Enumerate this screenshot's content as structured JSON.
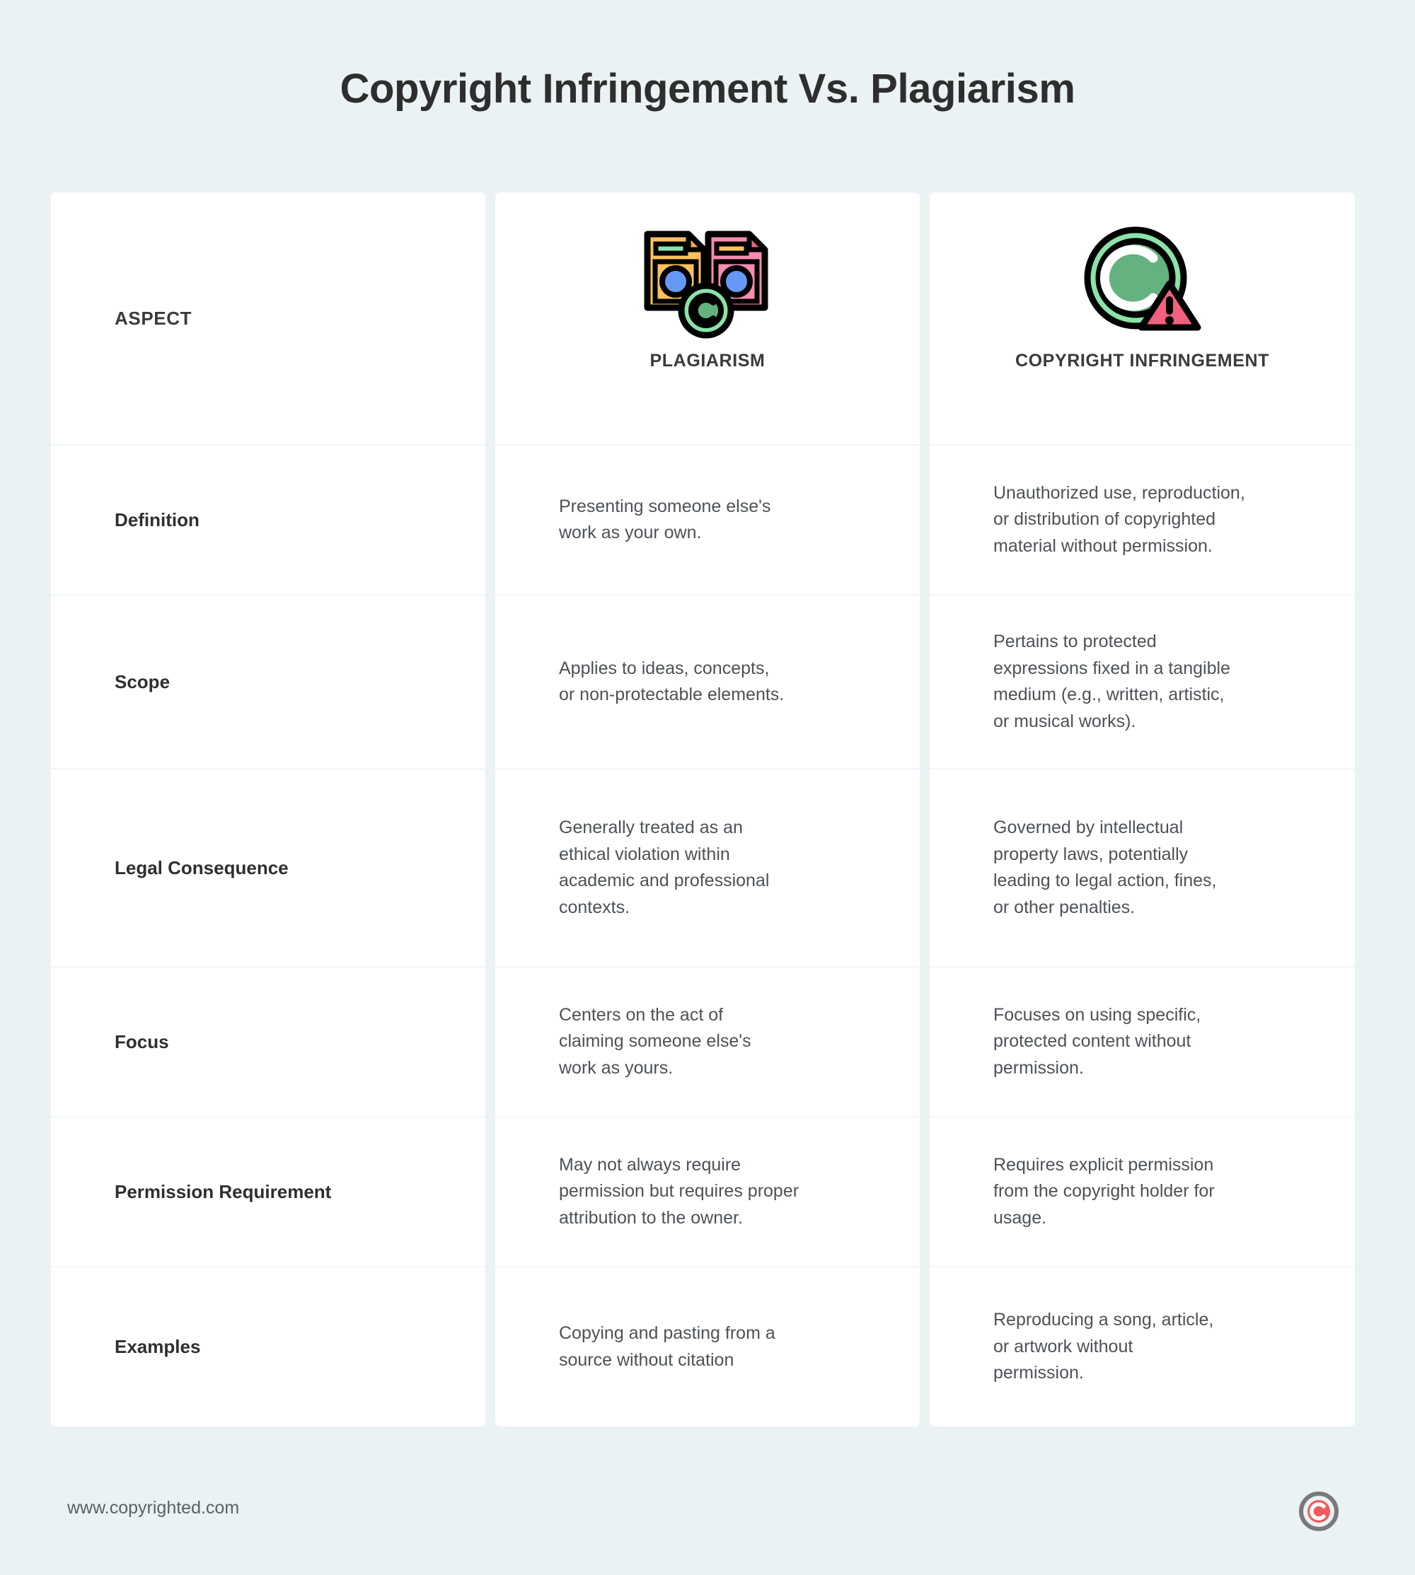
{
  "page": {
    "title": "Copyright Infringement Vs. Plagiarism",
    "background_color": "#eaf2f4",
    "card_color": "#ffffff"
  },
  "table": {
    "columns": [
      {
        "key": "aspect",
        "header": "ASPECT",
        "icon": "none"
      },
      {
        "key": "plagiarism",
        "header": "PLAGIARISM",
        "icon": "duplicate-documents-copyright-icon"
      },
      {
        "key": "copyright",
        "header": "COPYRIGHT INFRINGEMENT",
        "icon": "copyright-warning-icon"
      }
    ],
    "rows": [
      {
        "aspect": "Definition",
        "plagiarism": "Presenting someone else's\nwork as your own.",
        "copyright": "Unauthorized use, reproduction,\nor distribution of copyrighted\nmaterial without permission."
      },
      {
        "aspect": "Scope",
        "plagiarism": "Applies to ideas, concepts,\nor non-protectable elements.",
        "copyright": "Pertains to protected\nexpressions fixed in a tangible\nmedium (e.g., written, artistic,\nor musical works)."
      },
      {
        "aspect": "Legal Consequence",
        "plagiarism": "Generally treated as an\nethical violation within\nacademic and professional\ncontexts.",
        "copyright": "Governed by intellectual\nproperty laws, potentially\nleading to legal action, fines,\nor other penalties."
      },
      {
        "aspect": "Focus",
        "plagiarism": "Centers on the act of\nclaiming someone else's\nwork as yours.",
        "copyright": "Focuses on using specific,\nprotected content without\npermission."
      },
      {
        "aspect": "Permission Requirement",
        "plagiarism": "May not always require\npermission but requires proper\nattribution to the owner.",
        "copyright": "Requires explicit permission\nfrom the copyright holder for\nusage."
      },
      {
        "aspect": "Examples",
        "plagiarism": "Copying and pasting from a\nsource without citation",
        "copyright": "Reproducing a song, article,\nor artwork without\npermission."
      }
    ]
  },
  "footer": {
    "url": "www.copyrighted.com",
    "logo": "copyright-c-logo"
  },
  "colors": {
    "background": "#eaf2f4",
    "card": "#ffffff",
    "divider": "#f3f5f6",
    "title_text": "#2e2e2e",
    "body_text": "#4d5257",
    "aspect_text": "#2f2f2f",
    "icon_yellow": "#fbc15d",
    "icon_pink": "#f88bb0",
    "icon_green_light": "#8ae3a8",
    "icon_green_dark": "#63b27f",
    "icon_blue": "#6699f5",
    "icon_red": "#f4607f",
    "logo_red": "#ef5b5b",
    "logo_gray": "#7a7a7a"
  }
}
